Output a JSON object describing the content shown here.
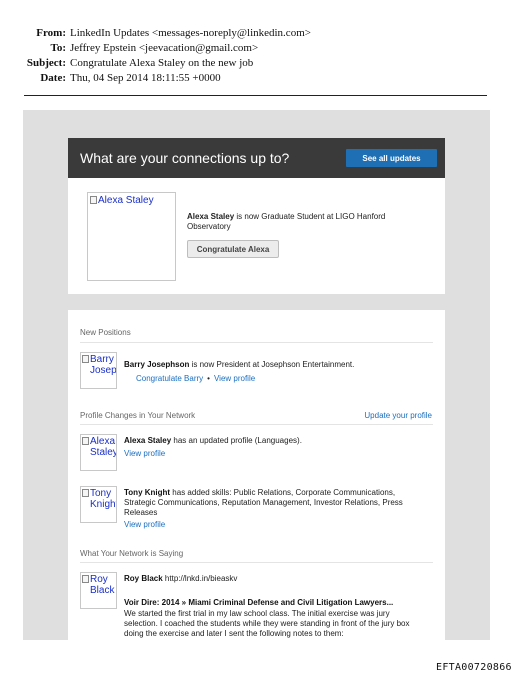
{
  "email": {
    "from_label": "From:",
    "from": "LinkedIn Updates <messages-noreply@linkedin.com>",
    "to_label": "To:",
    "to": "Jeffrey Epstein <jeevacation@gmail.com>",
    "subject_label": "Subject:",
    "subject": "Congratulate Alexa Staley on the new job",
    "date_label": "Date:",
    "date": "Thu, 04 Sep 2014 18:11:55 +0000"
  },
  "card1": {
    "title": "What are your connections up to?",
    "see_all_button": "See all updates",
    "photo_alt": "Alexa Staley",
    "name": "Alexa Staley",
    "headline": "is now Graduate Student at LIGO Hanford Observatory",
    "congratulate_button": "Congratulate Alexa"
  },
  "card2": {
    "new_positions": {
      "title": "New Positions",
      "photo_alt": "Barry Josephson",
      "name": "Barry Josephson",
      "text": "is now President at Josephson Entertainment.",
      "congratulate_link": "Congratulate Barry",
      "view_profile": "View profile"
    },
    "profile_changes": {
      "title": "Profile Changes in Your Network",
      "update_link": "Update your profile",
      "items": [
        {
          "photo_alt": "Alexa Staley",
          "name": "Alexa Staley",
          "text": "has an updated profile (Languages).",
          "view_profile": "View profile"
        },
        {
          "photo_alt": "Tony Knight",
          "name": "Tony Knight",
          "text": "has added skills: Public Relations, Corporate Communications, Strategic Communications, Reputation Management, Investor Relations, Press Releases",
          "view_profile": "View profile"
        }
      ]
    },
    "network_saying": {
      "title": "What Your Network is Saying",
      "photo_alt": "Roy Black",
      "name": "Roy Black",
      "url": "http://lnkd.in/bieaskv",
      "post_title": "Voir Dire: 2014 » Miami Criminal Defense and Civil Litigation Lawyers...",
      "post_body": "We started the first trial in my law school class. The initial exercise was jury selection. I coached the students while they were standing in front of the jury box doing the exercise and later I sent the following notes to them:"
    }
  },
  "footer_id": "EFTA00720866"
}
